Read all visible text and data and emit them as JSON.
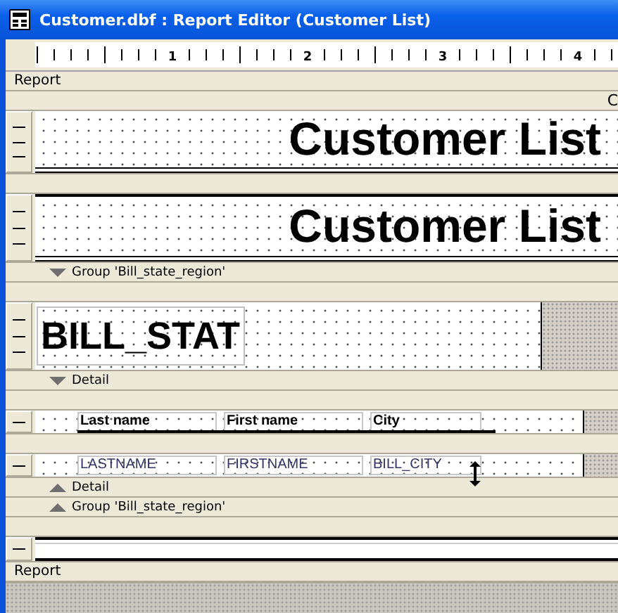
{
  "window": {
    "title": "Customer.dbf : Report Editor (Customer List)"
  },
  "ruler": {
    "labels": [
      "1",
      "2",
      "3",
      "4"
    ]
  },
  "rows": [
    {
      "kind": "label",
      "text": "Report"
    },
    {
      "kind": "label",
      "right_text": "C"
    },
    {
      "kind": "title",
      "text": "Customer List",
      "top_rule": false
    },
    {
      "kind": "blank"
    },
    {
      "kind": "title",
      "text": "Customer List",
      "top_rule": true
    },
    {
      "kind": "label",
      "text": "Group 'Bill_state_region'",
      "band_end": false
    },
    {
      "kind": "blank"
    },
    {
      "kind": "group-field",
      "text": "BILL_STAT"
    },
    {
      "kind": "label",
      "text": "Detail",
      "band_end": false
    },
    {
      "kind": "blank"
    },
    {
      "kind": "fields",
      "header": true,
      "resize_cursor": false,
      "fields": [
        "Last name",
        "First name",
        "City"
      ]
    },
    {
      "kind": "blank"
    },
    {
      "kind": "fields",
      "header": false,
      "resize_cursor": true,
      "fields": [
        "LASTNAME",
        "FIRSTNAME",
        "BILL_CITY"
      ]
    },
    {
      "kind": "label",
      "text": "Detail",
      "band_end": true
    },
    {
      "kind": "label",
      "text": "Group 'Bill_state_region'",
      "band_end": true
    },
    {
      "kind": "blank"
    },
    {
      "kind": "lines"
    },
    {
      "kind": "label",
      "text": "Report"
    }
  ]
}
